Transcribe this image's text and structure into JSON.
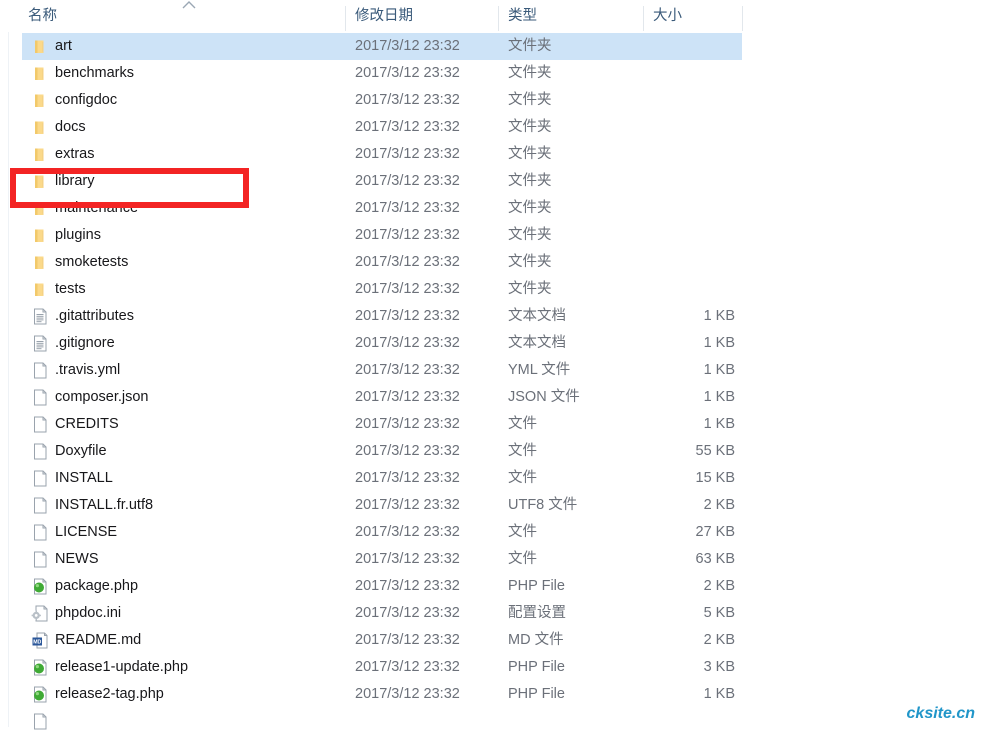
{
  "window": {
    "title": "File Explorer list view"
  },
  "header": {
    "sort_indicator": "chevron-up-icon",
    "columns": [
      {
        "key": "name",
        "label": "名称"
      },
      {
        "key": "date",
        "label": "修改日期"
      },
      {
        "key": "type",
        "label": "类型"
      },
      {
        "key": "size",
        "label": "大小"
      }
    ]
  },
  "annotation": {
    "color": "#f32424",
    "target": "library",
    "shape": "rectangle"
  },
  "watermark": {
    "text": "cksite.cn",
    "color": "#2196c9"
  },
  "rows": [
    {
      "name": "art",
      "date": "2017/3/12 23:32",
      "type": "文件夹",
      "size": "",
      "icon": "folder-icon",
      "selected": true
    },
    {
      "name": "benchmarks",
      "date": "2017/3/12 23:32",
      "type": "文件夹",
      "size": "",
      "icon": "folder-icon",
      "selected": false
    },
    {
      "name": "configdoc",
      "date": "2017/3/12 23:32",
      "type": "文件夹",
      "size": "",
      "icon": "folder-icon",
      "selected": false
    },
    {
      "name": "docs",
      "date": "2017/3/12 23:32",
      "type": "文件夹",
      "size": "",
      "icon": "folder-icon",
      "selected": false
    },
    {
      "name": "extras",
      "date": "2017/3/12 23:32",
      "type": "文件夹",
      "size": "",
      "icon": "folder-icon",
      "selected": false
    },
    {
      "name": "library",
      "date": "2017/3/12 23:32",
      "type": "文件夹",
      "size": "",
      "icon": "folder-icon",
      "selected": false
    },
    {
      "name": "maintenance",
      "date": "2017/3/12 23:32",
      "type": "文件夹",
      "size": "",
      "icon": "folder-icon",
      "selected": false
    },
    {
      "name": "plugins",
      "date": "2017/3/12 23:32",
      "type": "文件夹",
      "size": "",
      "icon": "folder-icon",
      "selected": false
    },
    {
      "name": "smoketests",
      "date": "2017/3/12 23:32",
      "type": "文件夹",
      "size": "",
      "icon": "folder-icon",
      "selected": false
    },
    {
      "name": "tests",
      "date": "2017/3/12 23:32",
      "type": "文件夹",
      "size": "",
      "icon": "folder-icon",
      "selected": false
    },
    {
      "name": ".gitattributes",
      "date": "2017/3/12 23:32",
      "type": "文本文档",
      "size": "1 KB",
      "icon": "text-file-icon",
      "selected": false
    },
    {
      "name": ".gitignore",
      "date": "2017/3/12 23:32",
      "type": "文本文档",
      "size": "1 KB",
      "icon": "text-file-icon",
      "selected": false
    },
    {
      "name": ".travis.yml",
      "date": "2017/3/12 23:32",
      "type": "YML 文件",
      "size": "1 KB",
      "icon": "blank-file-icon",
      "selected": false
    },
    {
      "name": "composer.json",
      "date": "2017/3/12 23:32",
      "type": "JSON 文件",
      "size": "1 KB",
      "icon": "blank-file-icon",
      "selected": false
    },
    {
      "name": "CREDITS",
      "date": "2017/3/12 23:32",
      "type": "文件",
      "size": "1 KB",
      "icon": "blank-file-icon",
      "selected": false
    },
    {
      "name": "Doxyfile",
      "date": "2017/3/12 23:32",
      "type": "文件",
      "size": "55 KB",
      "icon": "blank-file-icon",
      "selected": false
    },
    {
      "name": "INSTALL",
      "date": "2017/3/12 23:32",
      "type": "文件",
      "size": "15 KB",
      "icon": "blank-file-icon",
      "selected": false
    },
    {
      "name": "INSTALL.fr.utf8",
      "date": "2017/3/12 23:32",
      "type": "UTF8 文件",
      "size": "2 KB",
      "icon": "blank-file-icon",
      "selected": false
    },
    {
      "name": "LICENSE",
      "date": "2017/3/12 23:32",
      "type": "文件",
      "size": "27 KB",
      "icon": "blank-file-icon",
      "selected": false
    },
    {
      "name": "NEWS",
      "date": "2017/3/12 23:32",
      "type": "文件",
      "size": "63 KB",
      "icon": "blank-file-icon",
      "selected": false
    },
    {
      "name": "package.php",
      "date": "2017/3/12 23:32",
      "type": "PHP File",
      "size": "2 KB",
      "icon": "php-file-icon",
      "selected": false
    },
    {
      "name": "phpdoc.ini",
      "date": "2017/3/12 23:32",
      "type": "配置设置",
      "size": "5 KB",
      "icon": "config-file-icon",
      "selected": false
    },
    {
      "name": "README.md",
      "date": "2017/3/12 23:32",
      "type": "MD 文件",
      "size": "2 KB",
      "icon": "md-file-icon",
      "selected": false
    },
    {
      "name": "release1-update.php",
      "date": "2017/3/12 23:32",
      "type": "PHP File",
      "size": "3 KB",
      "icon": "php-file-icon",
      "selected": false
    },
    {
      "name": "release2-tag.php",
      "date": "2017/3/12 23:32",
      "type": "PHP File",
      "size": "1 KB",
      "icon": "php-file-icon",
      "selected": false
    },
    {
      "name": "",
      "date": "",
      "type": "",
      "size": "",
      "icon": "blank-file-icon",
      "selected": false
    }
  ]
}
